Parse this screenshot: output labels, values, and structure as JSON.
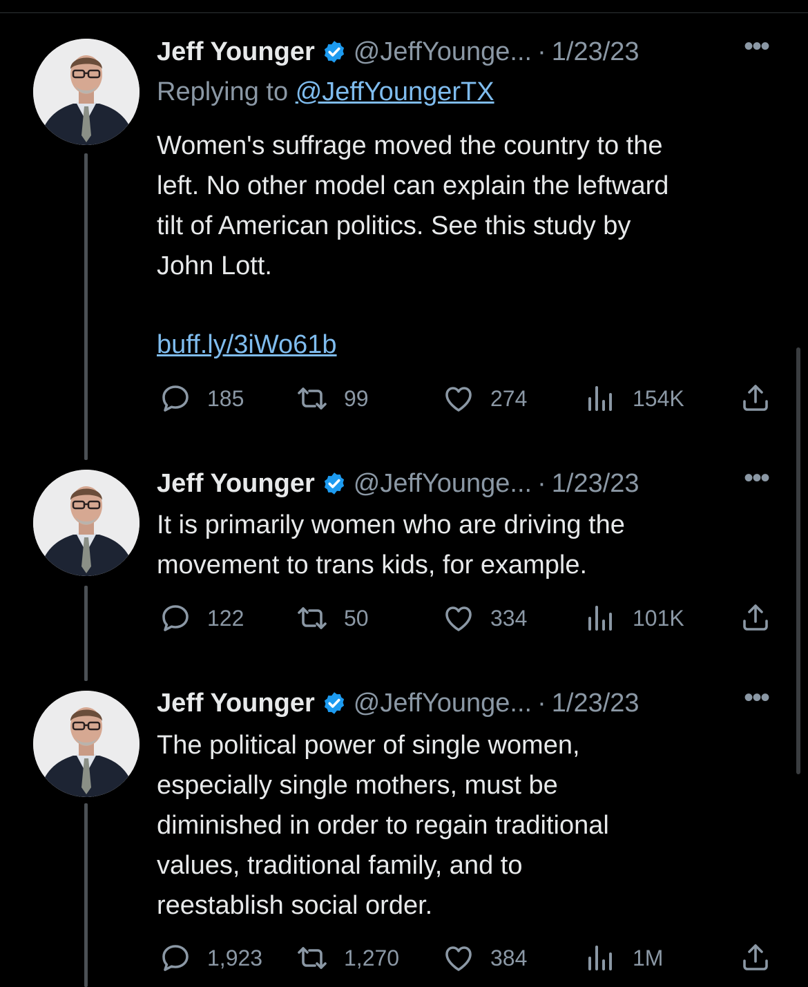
{
  "tweets": [
    {
      "name": "Jeff Younger",
      "handle": "@JeffYounge...",
      "separator": "·",
      "date": "1/23/23",
      "replying_prefix": "Replying to",
      "replying_handle": "@JeffYoungerTX",
      "text": "Women's suffrage moved the country to the\nleft. No other model can explain the leftward\ntilt of American politics. See this study by\nJohn Lott.",
      "link": "buff.ly/3iWo61b",
      "replies": "185",
      "retweets": "99",
      "likes": "274",
      "views": "154K"
    },
    {
      "name": "Jeff Younger",
      "handle": "@JeffYounge...",
      "separator": "·",
      "date": "1/23/23",
      "text": "It is primarily women who are driving the\nmovement to trans kids, for example.",
      "replies": "122",
      "retweets": "50",
      "likes": "334",
      "views": "101K"
    },
    {
      "name": "Jeff Younger",
      "handle": "@JeffYounge...",
      "separator": "·",
      "date": "1/23/23",
      "text": "The political power of single women,\nespecially single mothers, must be\ndiminished in order to regain traditional\nvalues, traditional family, and to\nreestablish social order.",
      "replies": "1,923",
      "retweets": "1,270",
      "likes": "384",
      "views": "1M"
    }
  ],
  "icons": {
    "more": "more-dots-icon",
    "verified": "verified-badge-icon",
    "reply": "reply-icon",
    "retweet": "retweet-icon",
    "like": "heart-icon",
    "views": "views-icon",
    "share": "share-icon"
  },
  "colors": {
    "background": "#000000",
    "text": "#e7e9ea",
    "muted": "#8b98a5",
    "link": "#7fbcee",
    "verified": "#1d9bf0"
  }
}
